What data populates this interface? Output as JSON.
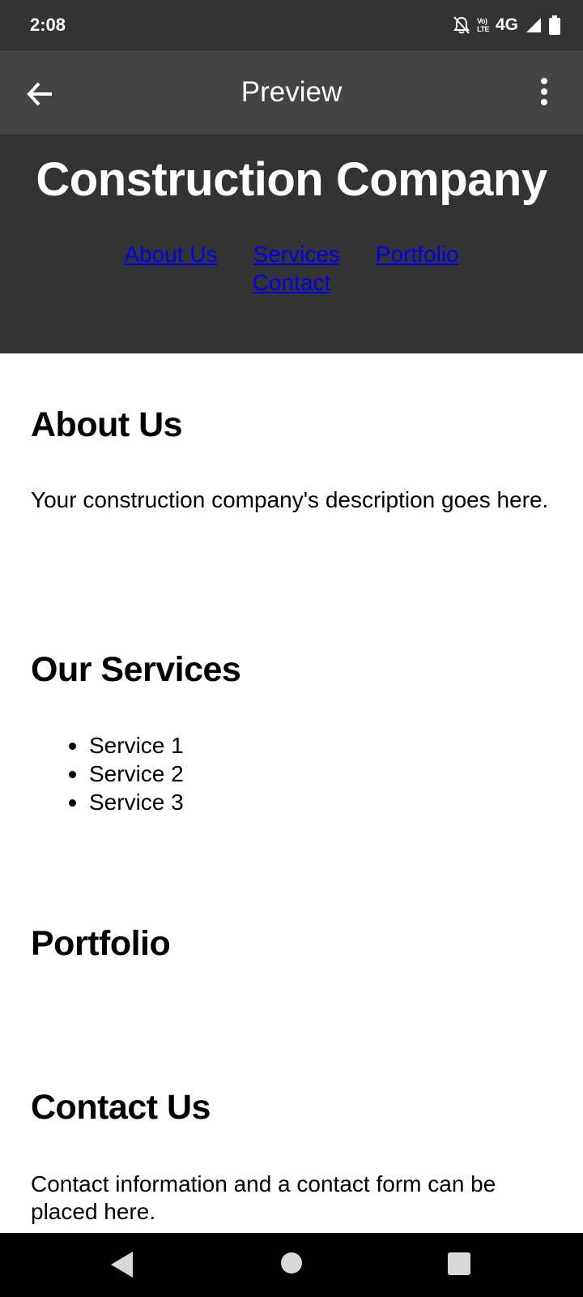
{
  "status_bar": {
    "time": "2:08",
    "volte_top": "Vo)",
    "volte_bottom": "LTE",
    "network": "4G"
  },
  "app_bar": {
    "title": "Preview",
    "back_icon": "arrow-back-icon",
    "menu_icon": "more-vert-icon"
  },
  "site": {
    "title": "Construction Company",
    "nav": [
      "About Us",
      "Services",
      "Portfolio",
      "Contact"
    ],
    "link_color": "#0000ee",
    "header_bg": "#333333"
  },
  "sections": {
    "about": {
      "heading": "About Us",
      "text": "Your construction company's description goes here."
    },
    "services": {
      "heading": "Our Services",
      "items": [
        "Service 1",
        "Service 2",
        "Service 3"
      ]
    },
    "portfolio": {
      "heading": "Portfolio"
    },
    "contact": {
      "heading": "Contact Us",
      "text": "Contact information and a contact form can be placed here."
    }
  },
  "system_nav": {
    "back": "back-triangle-icon",
    "home": "home-circle-icon",
    "recents": "recents-square-icon"
  }
}
